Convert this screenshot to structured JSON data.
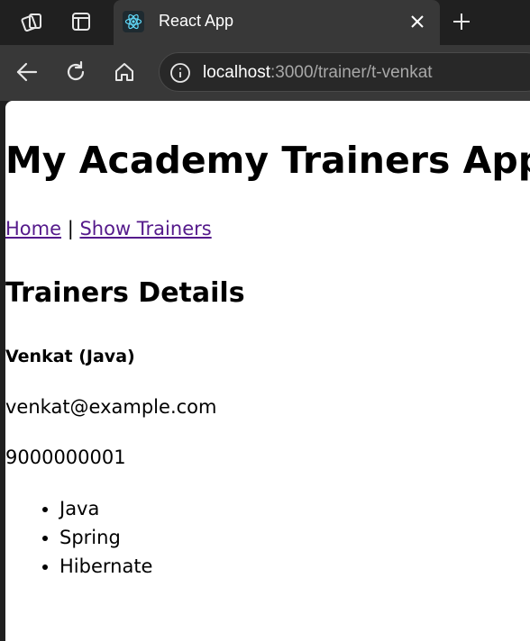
{
  "browser": {
    "tab": {
      "title": "React App",
      "favicon": "react-logo-icon"
    },
    "address": {
      "host": "localhost",
      "path": ":3000/trainer/t-venkat"
    },
    "icons": [
      "workspaces-icon",
      "tab-actions-icon",
      "close-icon",
      "plus-icon",
      "back-icon",
      "reload-icon",
      "home-icon",
      "info-icon"
    ],
    "colors": {
      "chrome_dark": "#202020",
      "chrome_tab": "#383838",
      "react_blue": "#61dafb"
    }
  },
  "page": {
    "title": "My Academy Trainers App",
    "nav": {
      "home": "Home",
      "separator": "|",
      "show_trainers": "Show Trainers"
    },
    "section_title": "Trainers Details",
    "trainer": {
      "name": "Venkat (Java)",
      "email": "venkat@example.com",
      "phone": "9000000001",
      "skills": [
        "Java",
        "Spring",
        "Hibernate"
      ]
    },
    "link_color": "#551a8b"
  }
}
